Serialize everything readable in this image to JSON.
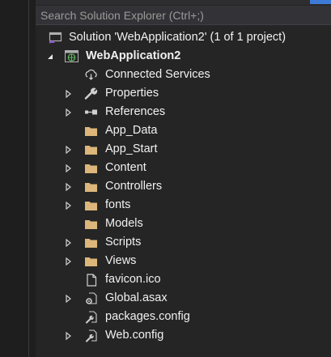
{
  "search": {
    "placeholder": "Search Solution Explorer (Ctrl+;)"
  },
  "solution": {
    "label": "Solution 'WebApplication2' (1 of 1 project)"
  },
  "project": {
    "label": "WebApplication2",
    "expanded": true
  },
  "items": [
    {
      "label": "Connected Services",
      "icon": "connected-services-icon",
      "expandable": false
    },
    {
      "label": "Properties",
      "icon": "wrench-icon",
      "expandable": true
    },
    {
      "label": "References",
      "icon": "references-icon",
      "expandable": true
    },
    {
      "label": "App_Data",
      "icon": "folder-icon",
      "expandable": false
    },
    {
      "label": "App_Start",
      "icon": "folder-icon",
      "expandable": true
    },
    {
      "label": "Content",
      "icon": "folder-icon",
      "expandable": true
    },
    {
      "label": "Controllers",
      "icon": "folder-icon",
      "expandable": true
    },
    {
      "label": "fonts",
      "icon": "folder-icon",
      "expandable": true
    },
    {
      "label": "Models",
      "icon": "folder-icon",
      "expandable": false
    },
    {
      "label": "Scripts",
      "icon": "folder-icon",
      "expandable": true
    },
    {
      "label": "Views",
      "icon": "folder-icon",
      "expandable": true
    },
    {
      "label": "favicon.ico",
      "icon": "file-icon",
      "expandable": false
    },
    {
      "label": "Global.asax",
      "icon": "gear-file-icon",
      "expandable": true
    },
    {
      "label": "packages.config",
      "icon": "config-file-icon",
      "expandable": false
    },
    {
      "label": "Web.config",
      "icon": "config-file-icon",
      "expandable": true
    }
  ],
  "colors": {
    "background": "#1e1e1e",
    "panel": "#252526",
    "text": "#f1f1f1",
    "placeholder": "#9a9a9a",
    "folder": "#dcb67a",
    "accent": "#3d7ad6"
  }
}
